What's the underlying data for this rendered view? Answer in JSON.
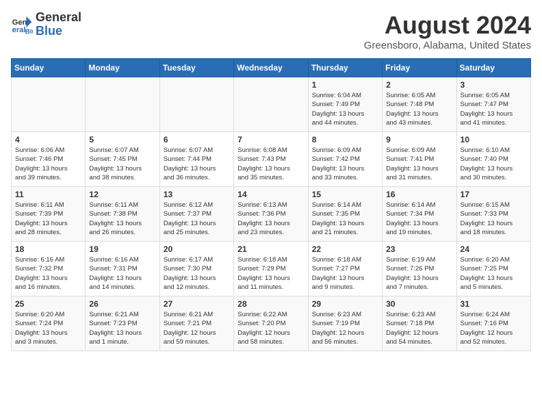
{
  "header": {
    "logo_general": "General",
    "logo_blue": "Blue",
    "title": "August 2024",
    "subtitle": "Greensboro, Alabama, United States"
  },
  "days_of_week": [
    "Sunday",
    "Monday",
    "Tuesday",
    "Wednesday",
    "Thursday",
    "Friday",
    "Saturday"
  ],
  "weeks": [
    [
      {
        "num": "",
        "info": ""
      },
      {
        "num": "",
        "info": ""
      },
      {
        "num": "",
        "info": ""
      },
      {
        "num": "",
        "info": ""
      },
      {
        "num": "1",
        "info": "Sunrise: 6:04 AM\nSunset: 7:49 PM\nDaylight: 13 hours\nand 44 minutes."
      },
      {
        "num": "2",
        "info": "Sunrise: 6:05 AM\nSunset: 7:48 PM\nDaylight: 13 hours\nand 43 minutes."
      },
      {
        "num": "3",
        "info": "Sunrise: 6:05 AM\nSunset: 7:47 PM\nDaylight: 13 hours\nand 41 minutes."
      }
    ],
    [
      {
        "num": "4",
        "info": "Sunrise: 6:06 AM\nSunset: 7:46 PM\nDaylight: 13 hours\nand 39 minutes."
      },
      {
        "num": "5",
        "info": "Sunrise: 6:07 AM\nSunset: 7:45 PM\nDaylight: 13 hours\nand 38 minutes."
      },
      {
        "num": "6",
        "info": "Sunrise: 6:07 AM\nSunset: 7:44 PM\nDaylight: 13 hours\nand 36 minutes."
      },
      {
        "num": "7",
        "info": "Sunrise: 6:08 AM\nSunset: 7:43 PM\nDaylight: 13 hours\nand 35 minutes."
      },
      {
        "num": "8",
        "info": "Sunrise: 6:09 AM\nSunset: 7:42 PM\nDaylight: 13 hours\nand 33 minutes."
      },
      {
        "num": "9",
        "info": "Sunrise: 6:09 AM\nSunset: 7:41 PM\nDaylight: 13 hours\nand 31 minutes."
      },
      {
        "num": "10",
        "info": "Sunrise: 6:10 AM\nSunset: 7:40 PM\nDaylight: 13 hours\nand 30 minutes."
      }
    ],
    [
      {
        "num": "11",
        "info": "Sunrise: 6:11 AM\nSunset: 7:39 PM\nDaylight: 13 hours\nand 28 minutes."
      },
      {
        "num": "12",
        "info": "Sunrise: 6:11 AM\nSunset: 7:38 PM\nDaylight: 13 hours\nand 26 minutes."
      },
      {
        "num": "13",
        "info": "Sunrise: 6:12 AM\nSunset: 7:37 PM\nDaylight: 13 hours\nand 25 minutes."
      },
      {
        "num": "14",
        "info": "Sunrise: 6:13 AM\nSunset: 7:36 PM\nDaylight: 13 hours\nand 23 minutes."
      },
      {
        "num": "15",
        "info": "Sunrise: 6:14 AM\nSunset: 7:35 PM\nDaylight: 13 hours\nand 21 minutes."
      },
      {
        "num": "16",
        "info": "Sunrise: 6:14 AM\nSunset: 7:34 PM\nDaylight: 13 hours\nand 19 minutes."
      },
      {
        "num": "17",
        "info": "Sunrise: 6:15 AM\nSunset: 7:33 PM\nDaylight: 13 hours\nand 18 minutes."
      }
    ],
    [
      {
        "num": "18",
        "info": "Sunrise: 6:16 AM\nSunset: 7:32 PM\nDaylight: 13 hours\nand 16 minutes."
      },
      {
        "num": "19",
        "info": "Sunrise: 6:16 AM\nSunset: 7:31 PM\nDaylight: 13 hours\nand 14 minutes."
      },
      {
        "num": "20",
        "info": "Sunrise: 6:17 AM\nSunset: 7:30 PM\nDaylight: 13 hours\nand 12 minutes."
      },
      {
        "num": "21",
        "info": "Sunrise: 6:18 AM\nSunset: 7:29 PM\nDaylight: 13 hours\nand 11 minutes."
      },
      {
        "num": "22",
        "info": "Sunrise: 6:18 AM\nSunset: 7:27 PM\nDaylight: 13 hours\nand 9 minutes."
      },
      {
        "num": "23",
        "info": "Sunrise: 6:19 AM\nSunset: 7:26 PM\nDaylight: 13 hours\nand 7 minutes."
      },
      {
        "num": "24",
        "info": "Sunrise: 6:20 AM\nSunset: 7:25 PM\nDaylight: 13 hours\nand 5 minutes."
      }
    ],
    [
      {
        "num": "25",
        "info": "Sunrise: 6:20 AM\nSunset: 7:24 PM\nDaylight: 13 hours\nand 3 minutes."
      },
      {
        "num": "26",
        "info": "Sunrise: 6:21 AM\nSunset: 7:23 PM\nDaylight: 13 hours\nand 1 minute."
      },
      {
        "num": "27",
        "info": "Sunrise: 6:21 AM\nSunset: 7:21 PM\nDaylight: 12 hours\nand 59 minutes."
      },
      {
        "num": "28",
        "info": "Sunrise: 6:22 AM\nSunset: 7:20 PM\nDaylight: 12 hours\nand 58 minutes."
      },
      {
        "num": "29",
        "info": "Sunrise: 6:23 AM\nSunset: 7:19 PM\nDaylight: 12 hours\nand 56 minutes."
      },
      {
        "num": "30",
        "info": "Sunrise: 6:23 AM\nSunset: 7:18 PM\nDaylight: 12 hours\nand 54 minutes."
      },
      {
        "num": "31",
        "info": "Sunrise: 6:24 AM\nSunset: 7:16 PM\nDaylight: 12 hours\nand 52 minutes."
      }
    ]
  ]
}
